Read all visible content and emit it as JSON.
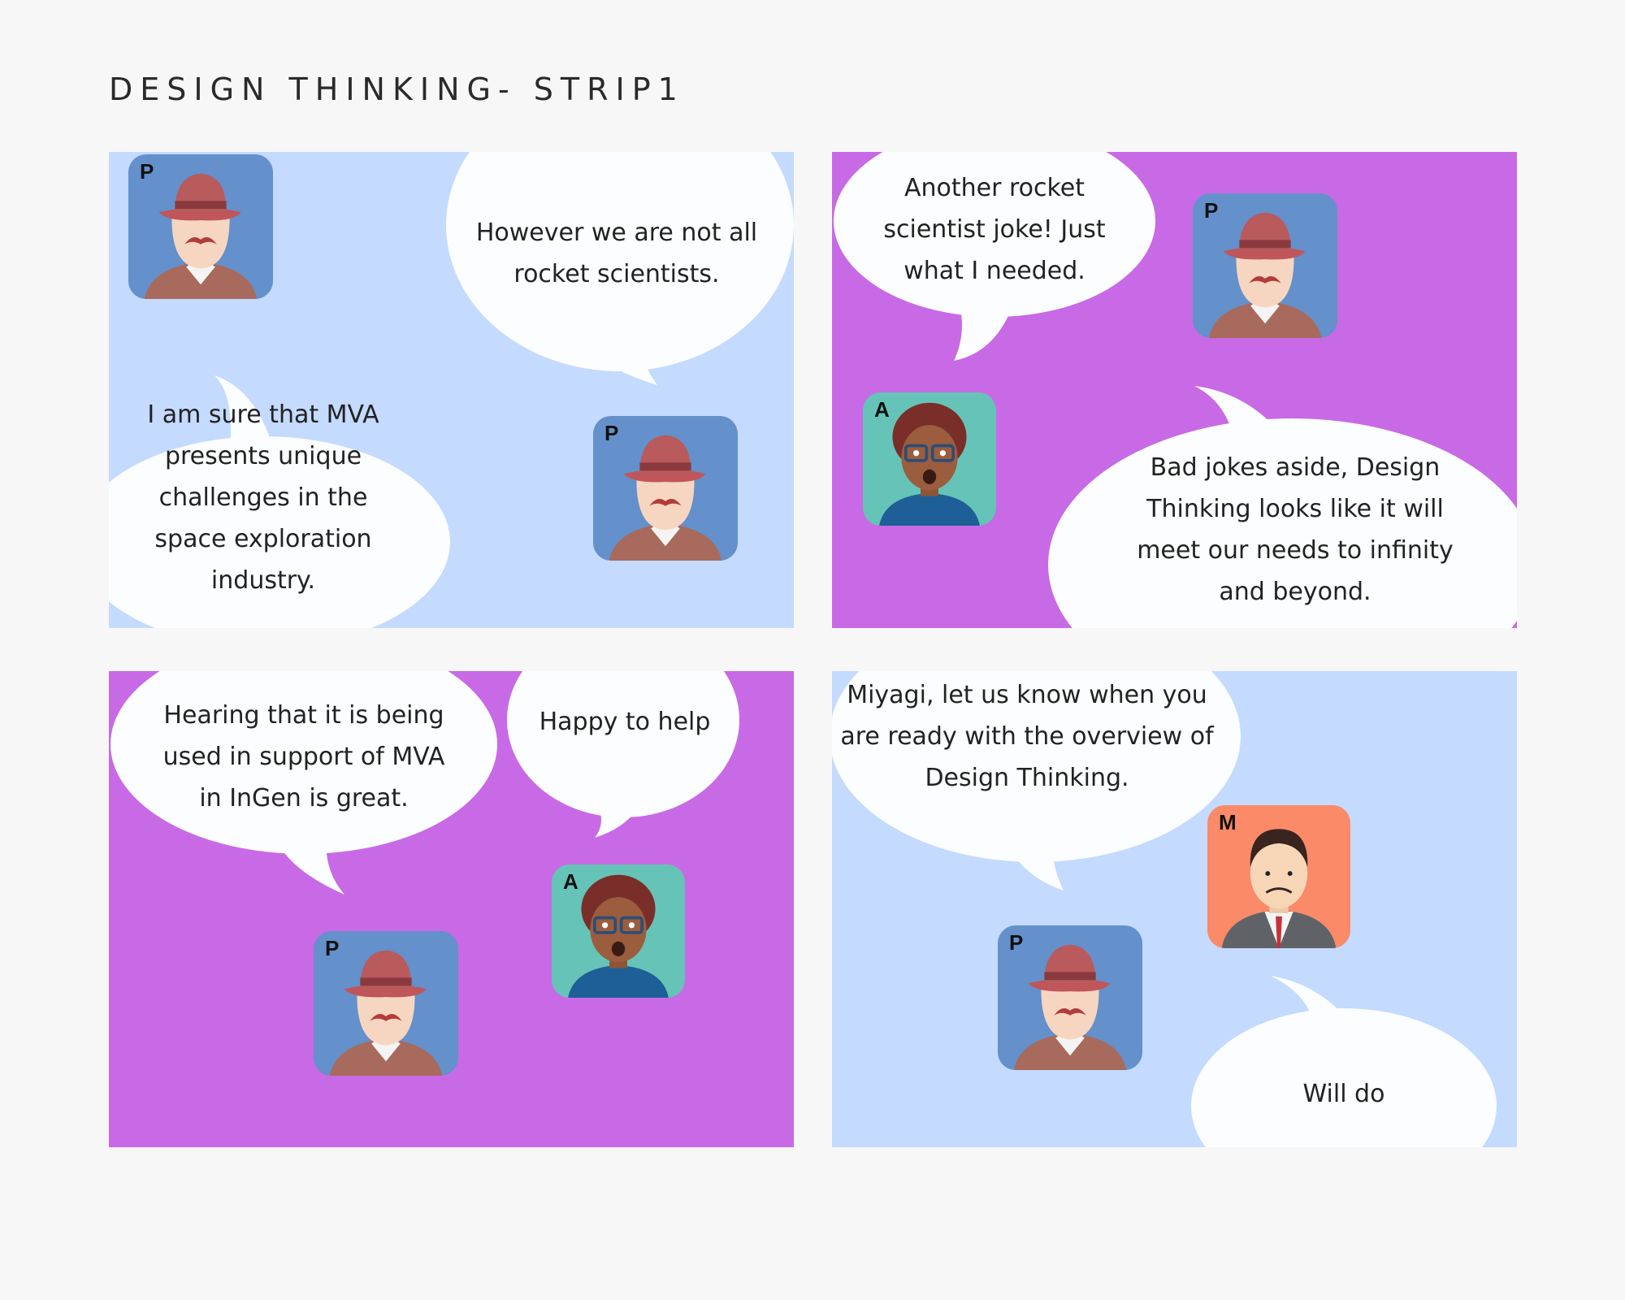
{
  "title": "DESIGN THINKING- STRIP1",
  "colors": {
    "light_blue": "#c4dafe",
    "purple": "#c86ae5",
    "bubble": "#fbfdfe"
  },
  "panels": [
    {
      "bubbles": [
        "However we are not all rocket scientists.",
        "I am sure that MVA presents unique challenges in the space exploration industry."
      ],
      "avatars": [
        "P",
        "P"
      ]
    },
    {
      "bubbles": [
        "Another rocket scientist joke! Just what I needed.",
        "Bad jokes aside, Design Thinking looks like it will meet our needs to infinity and beyond."
      ],
      "avatars": [
        "P",
        "A"
      ]
    },
    {
      "bubbles": [
        "Hearing that it is being used in support of MVA in InGen is great.",
        "Happy to help"
      ],
      "avatars": [
        "P",
        "A"
      ]
    },
    {
      "bubbles": [
        "Miyagi, let us know when you are ready with the overview of Design Thinking.",
        "Will do"
      ],
      "avatars": [
        "M",
        "P"
      ]
    }
  ]
}
